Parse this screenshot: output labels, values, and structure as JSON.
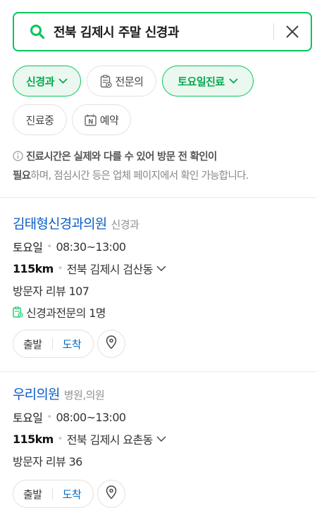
{
  "search": {
    "query": "전북 김제시 주말 신경과"
  },
  "filters": {
    "row1": [
      {
        "label": "신경과",
        "active": true,
        "chevron": true
      },
      {
        "label": "전문의",
        "active": false,
        "icon": "specialist-doc-icon"
      },
      {
        "label": "토요일진료",
        "active": true,
        "chevron": true
      }
    ],
    "row2": [
      {
        "label": "진료중",
        "active": false
      },
      {
        "label": "예약",
        "active": false,
        "icon": "naver-booking-icon"
      }
    ]
  },
  "notice": {
    "bold": "진료시간은 실제와 다를 수 있어 방문 전 확인이 필요",
    "bold_part1": "진료시간은 실제와 다를 수 있어 방문 전 확인이",
    "bold_part2": "필요",
    "rest": "하며, 점심시간 등은 업체 페이지에서 확인 가능합니다."
  },
  "results": [
    {
      "name": "김태형신경과의원",
      "category": "신경과",
      "day": "토요일",
      "hours": "08:30~13:00",
      "distance": "115km",
      "address": "전북 김제시 검산동",
      "reviews": "방문자 리뷰 107",
      "specialist": "신경과전문의 1명",
      "depart": "출발",
      "arrive": "도착"
    },
    {
      "name": "우리의원",
      "category": "병원,의원",
      "day": "토요일",
      "hours": "08:00~13:00",
      "distance": "115km",
      "address": "전북 김제시 요촌동",
      "reviews": "방문자 리뷰 36",
      "depart": "출발",
      "arrive": "도착"
    }
  ],
  "colors": {
    "brand": "#03c75a",
    "link": "#0b5cc5",
    "arrive": "#0068c3"
  }
}
